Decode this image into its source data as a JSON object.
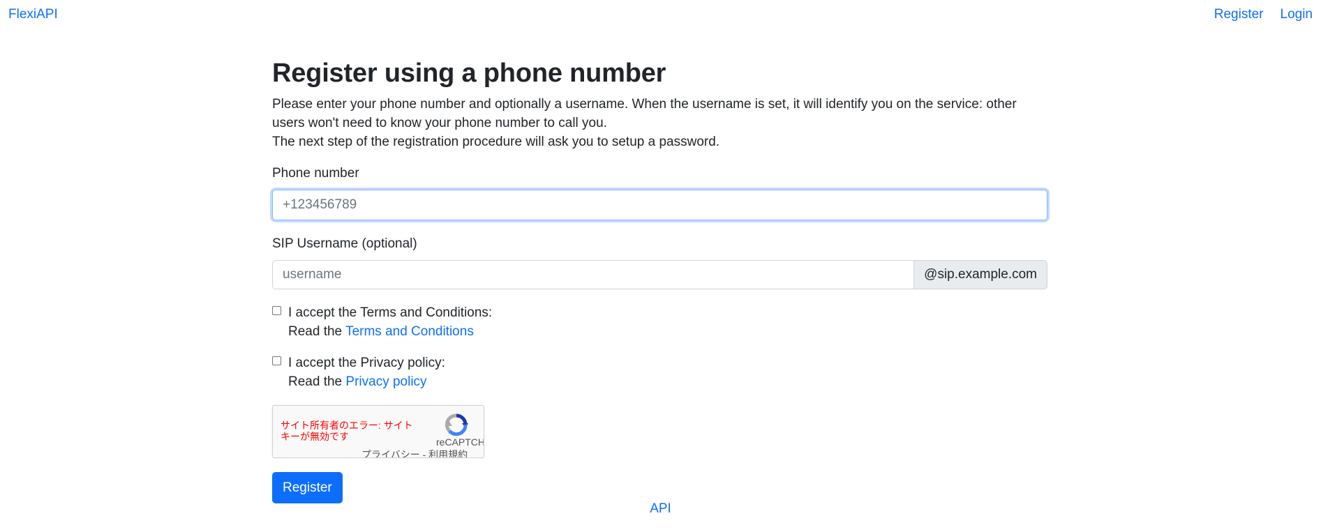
{
  "nav": {
    "brand": "FlexiAPI",
    "register": "Register",
    "login": "Login"
  },
  "page": {
    "title": "Register using a phone number",
    "intro_line1": "Please enter your phone number and optionally a username. When the username is set, it will identify you on the service: other users won't need to know your phone number to call you.",
    "intro_line2": "The next step of the registration procedure will ask you to setup a password."
  },
  "form": {
    "phone_label": "Phone number",
    "phone_placeholder": "+123456789",
    "phone_value": "",
    "sip_label": "SIP Username (optional)",
    "sip_placeholder": "username",
    "sip_value": "",
    "sip_domain_suffix": "@sip.example.com",
    "terms": {
      "accept_label": "I accept the Terms and Conditions:",
      "read_prefix": "Read the",
      "link": "Terms and Conditions",
      "checked": false
    },
    "privacy": {
      "accept_label": "I accept the Privacy policy:",
      "read_prefix": "Read the",
      "link": "Privacy policy",
      "checked": false
    },
    "recaptcha": {
      "error": "サイト所有者のエラー: サイトキーが無効です",
      "brand": "reCAPTCHA",
      "terms": "プライバシー - 利用規約"
    },
    "submit": "Register"
  },
  "footer": {
    "api_link": "API"
  },
  "colors": {
    "link": "#0d6efd",
    "primary_button": "#0d6efd",
    "error": "#ff0000"
  }
}
